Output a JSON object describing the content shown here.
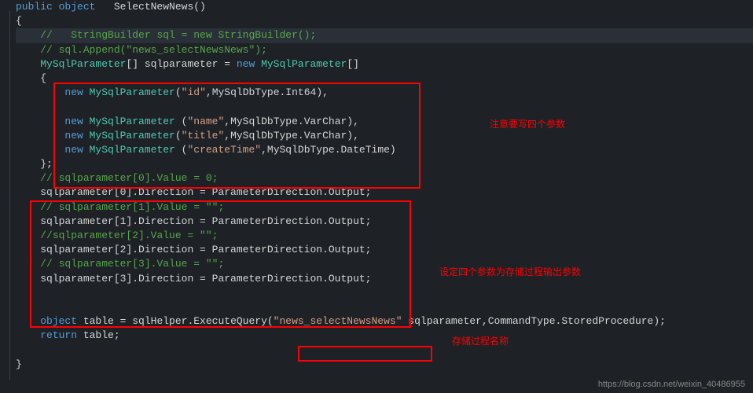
{
  "code": {
    "l1_public": "public",
    "l1_object": " object",
    "l1_method": "   SelectNewNews()",
    "l2": "{",
    "l3_comment": "//   StringBuilder sql = new StringBuilder();",
    "l4_comment": "// sql.Append(\"news_selectNewsNews\");",
    "l5a": "MySqlParameter",
    "l5b": "[] sqlparameter = ",
    "l5_new": "new",
    "l5c": " MySqlParameter",
    "l5d": "[]",
    "l6": "{",
    "l7_new": "new",
    "l7_type": " MySqlParameter",
    "l7_open": "(",
    "l7_str": "\"id\"",
    "l7_mid": ",MySqlDbType.Int64),",
    "l8_new": "new",
    "l8_type": " MySqlParameter ",
    "l8_open": "(",
    "l8_str": "\"name\"",
    "l8_mid": ",MySqlDbType.VarChar),",
    "l9_new": "new",
    "l9_type": " MySqlParameter",
    "l9_open": "(",
    "l9_str": "\"title\"",
    "l9_mid": ",MySqlDbType.VarChar),",
    "l10_new": "new",
    "l10_type": " MySqlParameter ",
    "l10_open": "(",
    "l10_str": "\"createTime\"",
    "l10_mid": ",MySqlDbType.DateTime)",
    "l11": "};",
    "l12_comment": "// sqlparameter[0].Value = 0;",
    "l13": "sqlparameter[0].Direction = ParameterDirection.Output;",
    "l14_comment": "// sqlparameter[1].Value = \"\";",
    "l15": "sqlparameter[1].Direction = ParameterDirection.Output;",
    "l16_comment": "//sqlparameter[2].Value = \"\";",
    "l17": "sqlparameter[2].Direction = ParameterDirection.Output;",
    "l18_comment": "// sqlparameter[3].Value = \"\";",
    "l19": "sqlparameter[3].Direction = ParameterDirection.Output;",
    "l20a": "object",
    "l20b": " table = sqlHelper.ExecuteQuery(",
    "l20_str": "\"news_selectNewsNews\"",
    "l20c": " sqlparameter,CommandType.StoredProcedure);",
    "l21_ret": "return",
    "l21_b": " table;",
    "l22": "}"
  },
  "annotations": {
    "a1": "注意要写四个参数",
    "a2": "设定四个参数为存储过程输出参数",
    "a3": "存储过程名称"
  },
  "watermark": "https://blog.csdn.net/weixin_40486955"
}
